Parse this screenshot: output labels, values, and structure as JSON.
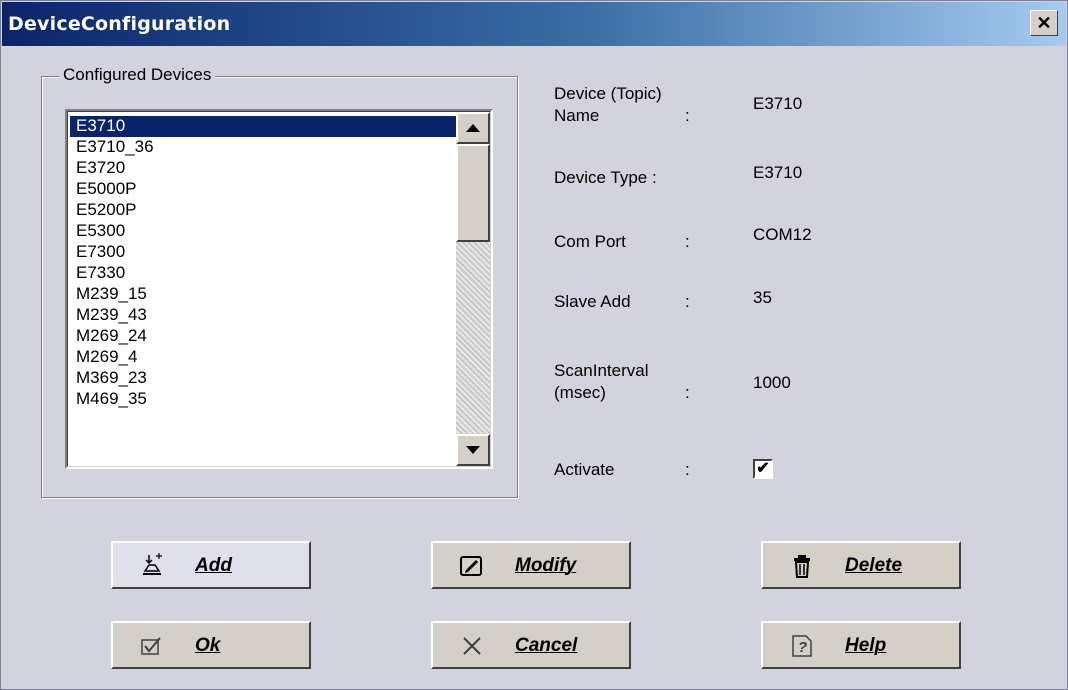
{
  "window": {
    "title": "DeviceConfiguration",
    "close_glyph": "✕"
  },
  "configured_devices": {
    "label": "Configured Devices",
    "items": [
      "E3710",
      "E3710_36",
      "E3720",
      "E5000P",
      "E5200P",
      "E5300",
      "E7300",
      "E7330",
      "M239_15",
      "M239_43",
      "M269_24",
      "M269_4",
      "M369_23",
      "M469_35"
    ],
    "selected": "E3710"
  },
  "details": {
    "device_name_label_1": "Device (Topic)",
    "device_name_label_2": "Name",
    "device_name_colon": ":",
    "device_name_value": "E3710",
    "device_type_label": "Device Type  :",
    "device_type_value": "E3710",
    "com_port_label": "Com Port",
    "com_port_colon": ":",
    "com_port_value": "COM12",
    "slave_add_label": "Slave Add",
    "slave_add_colon": ":",
    "slave_add_value": "35",
    "scan_interval_label_1": "ScanInterval",
    "scan_interval_label_2": "(msec)",
    "scan_interval_colon": ":",
    "scan_interval_value": "1000",
    "activate_label": "Activate",
    "activate_colon": ":",
    "activate_checked": true,
    "check_glyph": "✔"
  },
  "buttons": {
    "add": "Add",
    "modify": "Modify",
    "delete": "Delete",
    "ok": "Ok",
    "cancel": "Cancel",
    "help": "Help"
  },
  "icons": {
    "add": "add-device-icon",
    "modify": "edit-icon",
    "delete": "trash-icon",
    "ok": "check-box-icon",
    "cancel": "x-icon",
    "help": "help-icon"
  },
  "colors": {
    "selection": "#0a246a",
    "dialog_bg": "#d2d3de",
    "title_start": "#0b246a",
    "title_end": "#a6caf0"
  }
}
